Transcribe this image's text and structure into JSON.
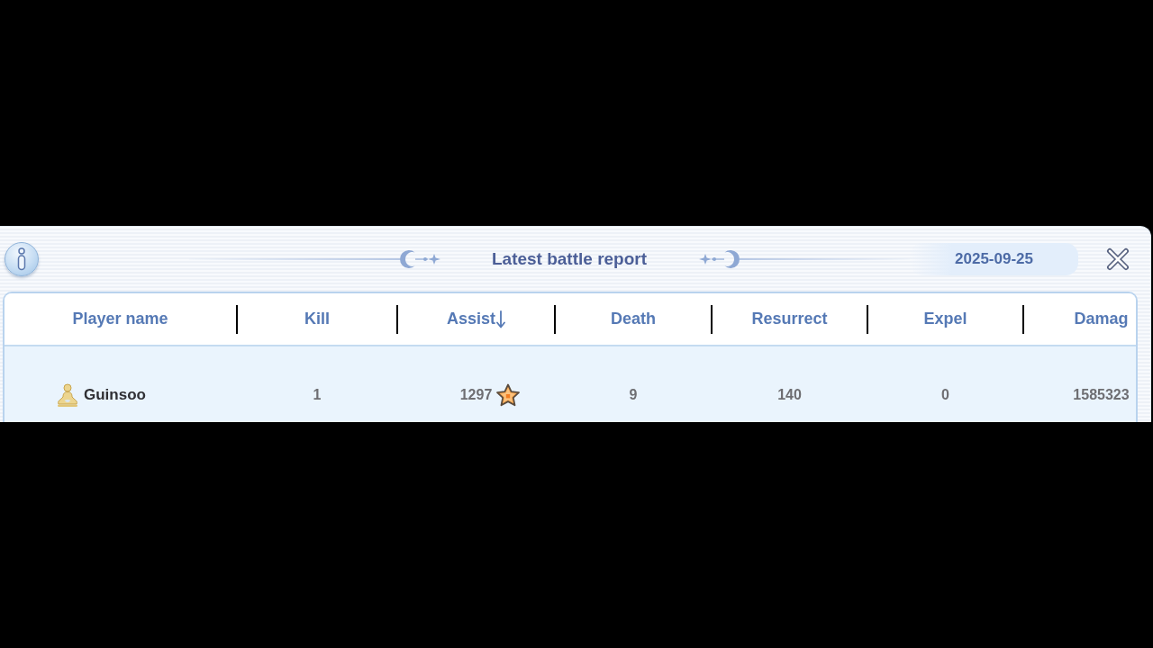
{
  "dialog": {
    "title": "Latest battle report",
    "date": "2025-09-25"
  },
  "table": {
    "columns": [
      {
        "label": "Player name",
        "sorted": false
      },
      {
        "label": "Kill",
        "sorted": false
      },
      {
        "label": "Assist",
        "sorted": true
      },
      {
        "label": "Death",
        "sorted": false
      },
      {
        "label": "Resurrect",
        "sorted": false
      },
      {
        "label": "Expel",
        "sorted": false
      },
      {
        "label": "Damag",
        "sorted": false
      }
    ],
    "rows": [
      {
        "cells": [
          {
            "kind": "player",
            "text": "Guinsoo"
          },
          {
            "kind": "number",
            "text": "1",
            "starred": false
          },
          {
            "kind": "number",
            "text": "1297",
            "starred": true
          },
          {
            "kind": "number",
            "text": "9",
            "starred": false
          },
          {
            "kind": "number",
            "text": "140",
            "starred": false
          },
          {
            "kind": "number",
            "text": "0",
            "starred": false
          },
          {
            "kind": "number",
            "text": "1585323",
            "starred": false
          }
        ]
      }
    ]
  }
}
